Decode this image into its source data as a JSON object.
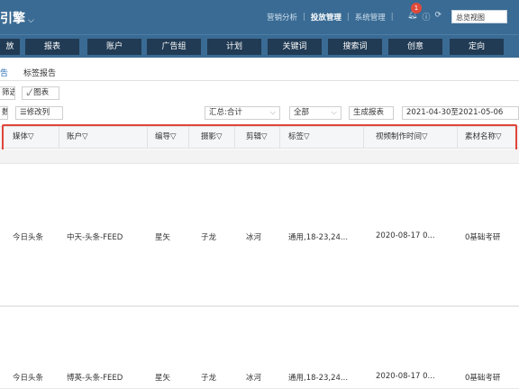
{
  "header": {
    "brand": "引擎",
    "nav": [
      "营销分析",
      "投放管理",
      "系统管理"
    ],
    "active_nav": "投放管理",
    "notification_count": "1",
    "overview_label": "总览视图"
  },
  "menu": [
    "放",
    "报表",
    "账户",
    "广告组",
    "计划",
    "关键词",
    "搜索词",
    "创意",
    "定向"
  ],
  "tabs": [
    "告",
    "标签报告"
  ],
  "toolbar": {
    "filter_label": "筛选",
    "chart_label": "图表",
    "data_label": "数",
    "edit_columns_label": "修改列",
    "summary_select": "汇总:合计",
    "scope_select": "全部",
    "generate_report_label": "生成报表",
    "date_range": "2021-04-30至2021-05-06"
  },
  "table": {
    "columns": [
      "媒体",
      "账户",
      "编导",
      "摄影",
      "剪辑",
      "标签",
      "视频制作时间",
      "素材名称"
    ],
    "rows": [
      [
        "今日头条",
        "中天-头条-FEED",
        "星矢",
        "子龙",
        "冰河",
        "通用,18-23,24...",
        "2020-08-17 0...",
        "0基础考研"
      ],
      [
        "今日头条",
        "博英-头条-FEED",
        "星矢",
        "子龙",
        "冰河",
        "通用,18-23,24...",
        "2020-08-17 0...",
        "0基础考研"
      ]
    ]
  },
  "colors": {
    "header_bg": "#3a6b94",
    "menu_button_bg": "#213b54",
    "highlight_border": "#e0453a",
    "active_tab": "#2a6db3"
  }
}
